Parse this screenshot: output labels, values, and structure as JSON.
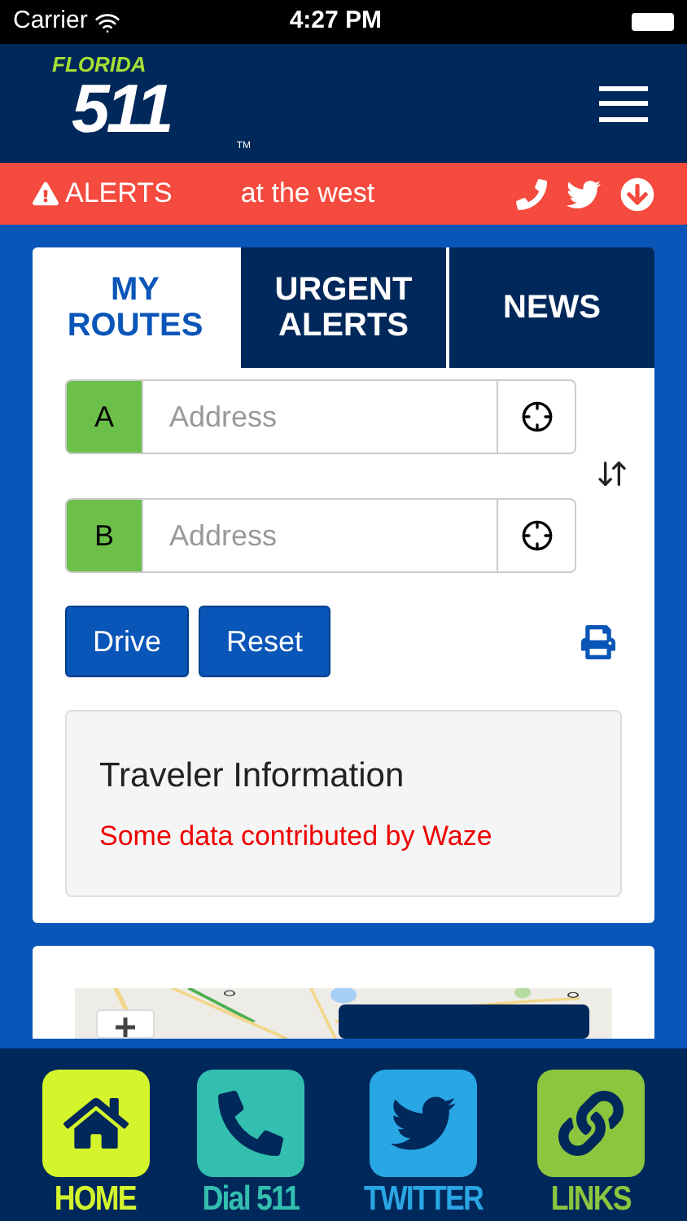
{
  "status_bar": {
    "carrier": "Carrier",
    "time": "4:27 PM"
  },
  "header": {
    "logo_top": "FLORIDA",
    "logo_main": "511",
    "logo_mark": "TM"
  },
  "alerts_bar": {
    "label": "ALERTS",
    "ticker": "at the west"
  },
  "tabs": [
    {
      "label": "MY ROUTES",
      "selected": true
    },
    {
      "label": "URGENT ALERTS",
      "selected": false
    },
    {
      "label": "NEWS",
      "selected": false
    }
  ],
  "route_fields": [
    {
      "letter": "A",
      "placeholder": "Address"
    },
    {
      "letter": "B",
      "placeholder": "Address"
    }
  ],
  "buttons": [
    "Drive",
    "Reset"
  ],
  "traveler_info": {
    "title": "Traveler Information",
    "note": "Some data contributed by Waze"
  },
  "bottom_nav": [
    {
      "kind": "home",
      "label": "HOME",
      "color": "#d4f52c"
    },
    {
      "kind": "phone",
      "label": "Dial 511",
      "color": "#33bfb0"
    },
    {
      "kind": "twitter",
      "label": "TWITTER",
      "color": "#29a6e4"
    },
    {
      "kind": "link",
      "label": "LINKS",
      "color": "#8cc63f"
    }
  ]
}
